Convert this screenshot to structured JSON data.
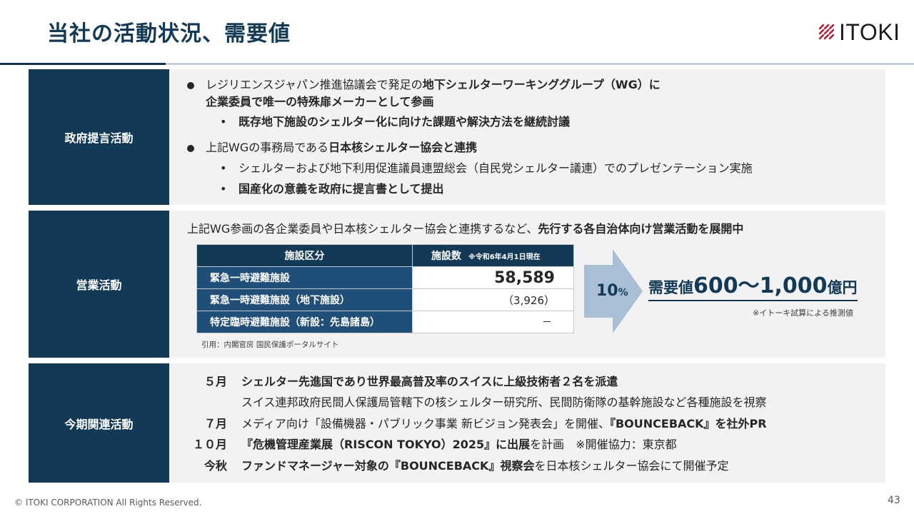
{
  "title": "当社の活動状況、需要値",
  "brand": {
    "logo_text": "ITOKI",
    "accent_color": "#C8102E"
  },
  "sections": {
    "government": {
      "label": "政府提言活動",
      "bullet1": {
        "text_a": "レジリエンスジャパン推進協議会で発足の",
        "text_b": "地下シェルターワーキンググループ（WG）に",
        "text_c": "企業委員で唯一の特殊扉メーカーとして参画",
        "sub1": "既存地下施設のシェルター化に向けた課題や解決方法を継続討議"
      },
      "bullet2": {
        "text_a": "上記WGの事務局である",
        "text_b": "日本核シェルター協会と連携",
        "sub1": "シェルターおよび地下利用促進議員連盟総会（自民党シェルター議連）でのプレゼンテーション実施",
        "sub2": "国産化の意義を政府に提言書として提出"
      }
    },
    "sales": {
      "label": "営業活動",
      "intro_a": "上記WG参画の各企業委員や日本核シェルター協会と連携するなど、",
      "intro_b": "先行する各自治体向け営業活動を展開中",
      "table": {
        "header_category": "施設区分",
        "header_count": "施設数",
        "header_note": "※令和6年4月1日現在",
        "rows": [
          {
            "category": "緊急一時避難施設",
            "count": "58,589"
          },
          {
            "category": "緊急一時避難施設（地下施設）",
            "count": "（3,926）"
          },
          {
            "category": "特定臨時避難施設（新設：先島諸島）",
            "count": "－"
          }
        ]
      },
      "source": "引用：内閣官房 国民保護ポータルサイト",
      "arrow_value": "10",
      "arrow_unit": "%",
      "demand_prefix": "需要値",
      "demand_value": "600～1,000",
      "demand_unit": "億円",
      "demand_note": "※イトーキ試算による推測値"
    },
    "period": {
      "label": "今期関連活動",
      "items": [
        {
          "month": "５月",
          "text_bold": "シェルター先進国であり世界最高普及率のスイスに上級技術者２名を派遣",
          "text": ""
        },
        {
          "month": "",
          "text_bold": "",
          "text": "スイス連邦政府民間人保護局管轄下の核シェルター研究所、民間防衛隊の基幹施設など各種施設を視察"
        },
        {
          "month": "７月",
          "text": "メディア向け「設備機器・パブリック事業 新ビジョン発表会」を開催、",
          "text_bold": "『BOUNCEBACK』を社外PR"
        },
        {
          "month": "１０月",
          "text_bold": "『危機管理産業展（RISCON TOKYO）2025』に出展",
          "text": "を計画　※開催協力：東京都"
        },
        {
          "month": "今秋",
          "text_bold": "ファンドマネージャー対象の『BOUNCEBACK』視察会",
          "text": "を日本核シェルター協会にて開催予定"
        }
      ]
    }
  },
  "footer": "© ITOKI CORPORATION All Rights Reserved.",
  "page_number": "43"
}
